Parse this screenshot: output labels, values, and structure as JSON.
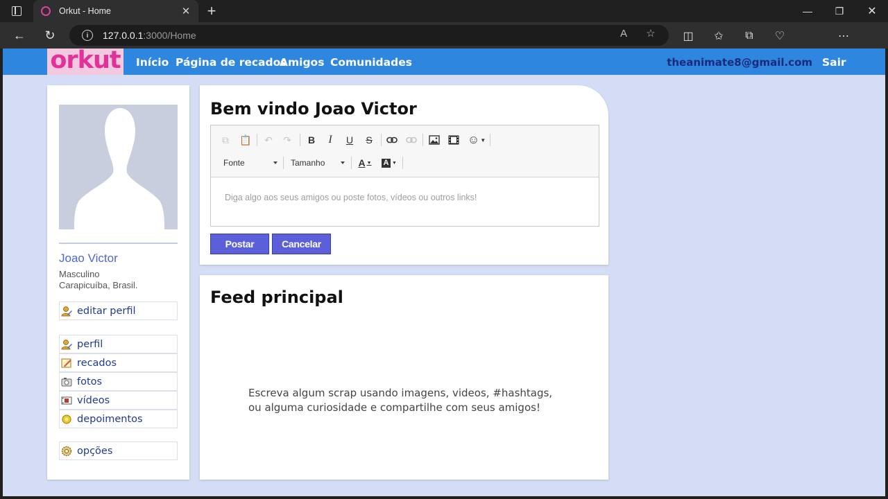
{
  "browser": {
    "tab_title": "Orkut - Home",
    "url_host": "127.0.0.1",
    "url_rest": ":3000/Home",
    "favicon_color": "#e040a0"
  },
  "nav": {
    "logo": "orkut",
    "links": [
      "Início",
      "Página de recados",
      "Amigos",
      "Comunidades"
    ],
    "email": "theanimate8@gmail.com",
    "logout": "Sair"
  },
  "profile": {
    "name": "Joao Victor",
    "gender": "Masculino",
    "location": "Carapicuíba, Brasil.",
    "edit": {
      "label": "editar perfil",
      "icon": "user-edit-icon"
    },
    "menu": [
      {
        "label": "perfil",
        "icon": "user-icon"
      },
      {
        "label": "recados",
        "icon": "note-icon"
      },
      {
        "label": "fotos",
        "icon": "camera-icon"
      },
      {
        "label": "vídeos",
        "icon": "film-icon"
      },
      {
        "label": "depoimentos",
        "icon": "star-badge-icon"
      }
    ],
    "options": {
      "label": "opções",
      "icon": "gear-icon"
    }
  },
  "welcome": {
    "title": "Bem vindo Joao Victor",
    "editor": {
      "font_label": "Fonte",
      "size_label": "Tamanho",
      "placeholder": "Diga algo aos seus amigos ou poste fotos, vídeos ou outros links!"
    },
    "post_button": "Postar",
    "cancel_button": "Cancelar"
  },
  "feed": {
    "title": "Feed principal",
    "empty_message": "Escreva algum scrap usando imagens, videos, #hashtags, ou alguma curiosidade e compartilhe com seus amigos!"
  },
  "colors": {
    "nav_bg": "#2f86df",
    "page_bg": "#d4dcf6",
    "accent_button": "#5b5fd9",
    "logo_pink": "#e1329b"
  }
}
